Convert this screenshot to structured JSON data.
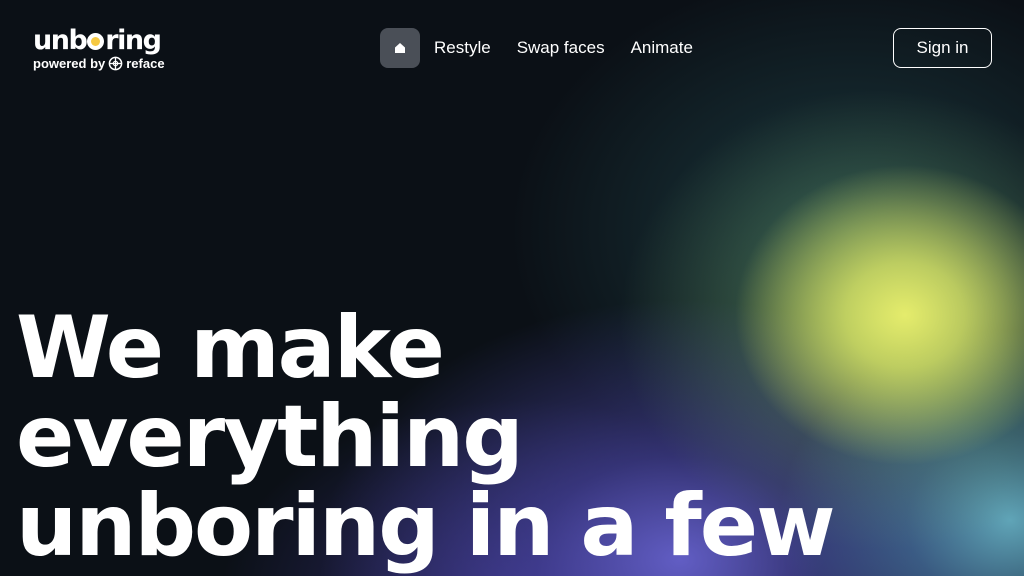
{
  "header": {
    "logo": {
      "word_before": "unb",
      "word_after": "ring",
      "powered_by": "powered by",
      "partner": "reface"
    },
    "nav": {
      "home_icon": "home-icon",
      "items": [
        {
          "label": "Restyle"
        },
        {
          "label": "Swap faces"
        },
        {
          "label": "Animate"
        }
      ]
    },
    "sign_in_label": "Sign in"
  },
  "hero": {
    "headline_lines": [
      "We make",
      "everything",
      "unboring in a few"
    ]
  },
  "colors": {
    "background": "#0b1016",
    "accent_yellow": "#ecf26e",
    "accent_purple": "#6e69dc",
    "accent_blue": "#6ebed2",
    "logo_dot": "#f6c943",
    "home_button_bg": "#4a4f57"
  }
}
